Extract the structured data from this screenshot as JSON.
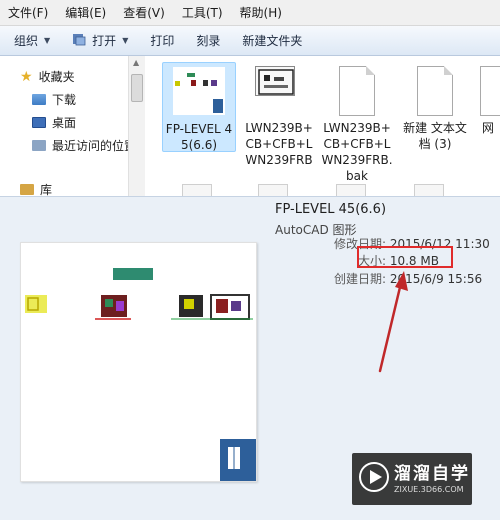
{
  "menu": [
    "文件(F)",
    "编辑(E)",
    "查看(V)",
    "工具(T)",
    "帮助(H)"
  ],
  "toolbar": {
    "organize": "组织",
    "open": "打开",
    "print": "打印",
    "burn": "刻录",
    "new_folder": "新建文件夹"
  },
  "nav": {
    "favorites": "收藏夹",
    "downloads": "下载",
    "desktop": "桌面",
    "recent": "最近访问的位置",
    "library": "库"
  },
  "files": [
    {
      "name": "FP-LEVEL 45(6.6)",
      "selected": true,
      "icon": "autocad-drawing-thumbnail-icon"
    },
    {
      "name": "LWN239B+CB+CFB+LWN239FRB",
      "selected": false,
      "icon": "autocad-drawing-thumbnail-icon"
    },
    {
      "name": "LWN239B+CB+CFB+LWN239FRB.bak",
      "selected": false,
      "icon": "blank-document-icon"
    },
    {
      "name": "新建 文本文档 (3)",
      "selected": false,
      "icon": "text-document-icon"
    },
    {
      "name": "网",
      "selected": false,
      "icon": "document-icon"
    }
  ],
  "details": {
    "title": "FP-LEVEL 45(6.6)",
    "type": "AutoCAD 图形",
    "modified_label": "修改日期:",
    "modified_value": "2015/6/12 11:30",
    "size_label": "大小:",
    "size_value": "10.8 MB",
    "created_label": "创建日期:",
    "created_value": "2015/6/9 15:56"
  },
  "watermark": {
    "title": "溜溜自学",
    "url": "ZIXUE.3D66.COM"
  },
  "colors": {
    "highlight_box": "#e02b2b",
    "arrow": "#c0282a",
    "selection": "#cce8ff"
  }
}
